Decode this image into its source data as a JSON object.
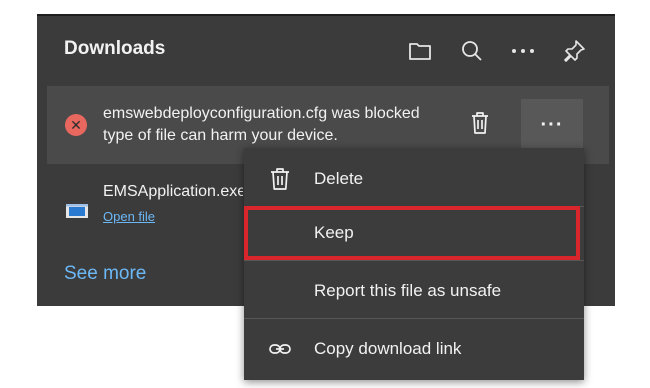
{
  "header": {
    "title": "Downloads",
    "icons": [
      "folder-icon",
      "search-icon",
      "more-icon",
      "pin-icon"
    ]
  },
  "blocked_item": {
    "message_line1": "emswebdeployconfiguration.cfg was blocked",
    "message_line2": "type of file can harm your device.",
    "status_icon": "error-icon",
    "more_label": "···"
  },
  "download_item": {
    "file_name": "EMSApplication.exe",
    "open_label": "Open file"
  },
  "see_more": "See more",
  "context_menu": {
    "items": [
      {
        "label": "Delete",
        "icon": "trash-icon"
      },
      {
        "label": "Keep",
        "icon": ""
      },
      {
        "label": "Report this file as unsafe",
        "icon": ""
      },
      {
        "label": "Copy download link",
        "icon": "link-icon"
      }
    ],
    "highlight_color": "#d9262c"
  }
}
